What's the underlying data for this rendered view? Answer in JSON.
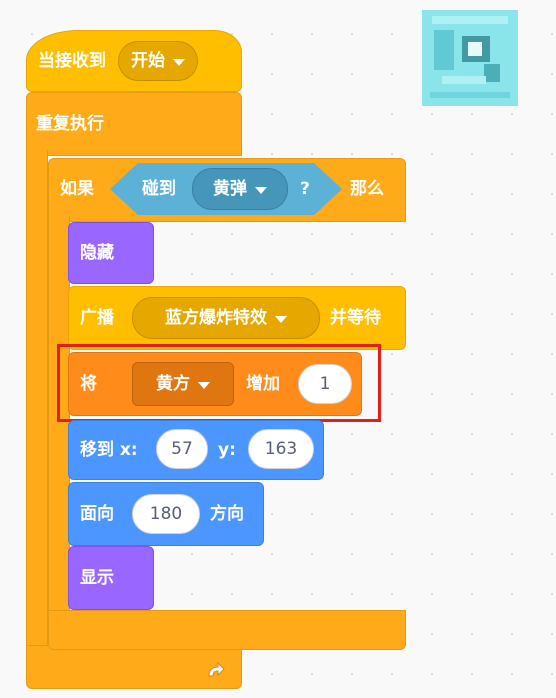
{
  "blocks": {
    "when_receive": {
      "label": "当接收到",
      "message": "开始"
    },
    "forever": {
      "label": "重复执行"
    },
    "if_block": {
      "if_label": "如果",
      "then_label": "那么"
    },
    "touching": {
      "label": "碰到",
      "target": "黄弹",
      "question": "?"
    },
    "hide": {
      "label": "隐藏"
    },
    "broadcast": {
      "label": "广播",
      "message": "蓝方爆炸特效",
      "wait_label": "并等待"
    },
    "change_var": {
      "label": "将",
      "variable": "黄方",
      "by_label": "增加",
      "value": "1"
    },
    "goto_xy": {
      "label": "移到 x:",
      "x": "57",
      "y_label": "y:",
      "y": "163"
    },
    "point_dir": {
      "label": "面向",
      "value": "180",
      "unit_label": "方向"
    },
    "show": {
      "label": "显示"
    }
  },
  "colors": {
    "events": "#ffbf00",
    "control": "#ffab19",
    "looks": "#9966ff",
    "variables": "#ff8c1a",
    "motion": "#4c97ff",
    "sensing": "#5cb1d6",
    "highlight": "#e0201b"
  },
  "icons": {
    "loop_arrow": "loop-arrow-icon",
    "sprite_thumb": "sprite-thumbnail"
  }
}
